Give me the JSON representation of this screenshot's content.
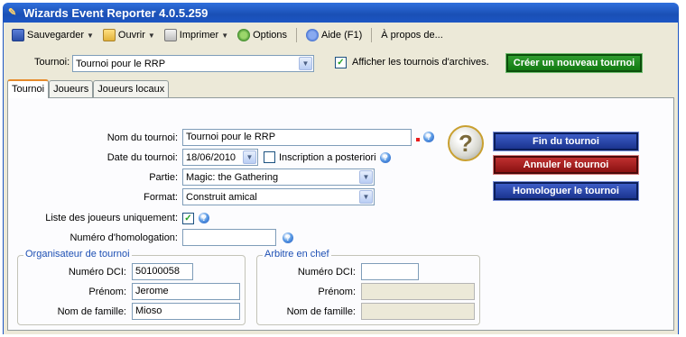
{
  "window": {
    "title": "Wizards Event Reporter 4.0.5.259"
  },
  "toolbar": {
    "save_label": "Sauvegarder",
    "open_label": "Ouvrir",
    "print_label": "Imprimer",
    "options_label": "Options",
    "help_label": "Aide (F1)",
    "about_label": "À propos de..."
  },
  "tournament_bar": {
    "label": "Tournoi:",
    "selected": "Tournoi pour le RRP",
    "archive_label": "Afficher les tournois d'archives.",
    "archive_checked": true,
    "create_button": "Créer un nouveau tournoi"
  },
  "tabs": [
    {
      "label": "Tournoi",
      "active": true
    },
    {
      "label": "Joueurs",
      "active": false
    },
    {
      "label": "Joueurs locaux",
      "active": false
    }
  ],
  "form": {
    "name_label": "Nom du tournoi:",
    "name_value": "Tournoi pour le RRP",
    "date_label": "Date du tournoi:",
    "date_value": "18/06/2010",
    "late_label": "Inscription a posteriori",
    "late_checked": false,
    "game_label": "Partie:",
    "game_value": "Magic: the Gathering",
    "format_label": "Format:",
    "format_value": "Construit amical",
    "players_only_label": "Liste des joueurs uniquement:",
    "players_only_checked": true,
    "sanction_label": "Numéro d'homologation:",
    "sanction_value": ""
  },
  "actions": {
    "end_button": "Fin du tournoi",
    "cancel_button": "Annuler le tournoi",
    "sanction_button": "Homologuer le tournoi"
  },
  "organizer": {
    "title": "Organisateur de tournoi",
    "dci_label": "Numéro DCI:",
    "dci_value": "50100058",
    "first_label": "Prénom:",
    "first_value": "Jerome",
    "last_label": "Nom de famille:",
    "last_value": "Mioso"
  },
  "head_judge": {
    "title": "Arbitre en chef",
    "dci_label": "Numéro DCI:",
    "dci_value": "",
    "first_label": "Prénom:",
    "first_value": "",
    "last_label": "Nom de famille:",
    "last_value": ""
  },
  "icons": {
    "help_icon_glyph": "?",
    "checkmark_glyph": "✓",
    "dropdown_glyph": "▼"
  }
}
